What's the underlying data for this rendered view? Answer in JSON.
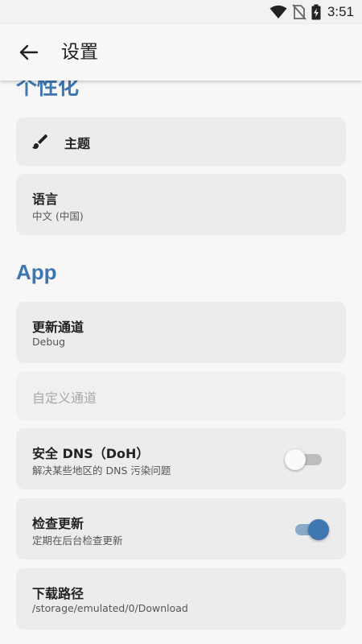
{
  "status_bar": {
    "time": "3:51"
  },
  "app_bar": {
    "title": "设置"
  },
  "sections": {
    "personalization": {
      "header": "个性化"
    },
    "app": {
      "header": "App"
    }
  },
  "items": {
    "theme": {
      "title": "主题"
    },
    "language": {
      "title": "语言",
      "value": "中文 (中国)"
    },
    "update_channel": {
      "title": "更新通道",
      "value": "Debug"
    },
    "custom_channel": {
      "placeholder": "自定义通道"
    },
    "secure_dns": {
      "title": "安全 DNS（DoH）",
      "subtitle": "解决某些地区的 DNS 污染问题",
      "enabled": false
    },
    "check_updates": {
      "title": "检查更新",
      "subtitle": "定期在后台检查更新",
      "enabled": true
    },
    "download_path": {
      "title": "下载路径",
      "value": "/storage/emulated/0/Download"
    }
  },
  "colors": {
    "accent": "#3d76b0",
    "card_background": "#ececec",
    "page_background": "#f7f7f7"
  },
  "icons": [
    "wifi-icon",
    "no-sim-icon",
    "battery-charging-icon",
    "back-arrow-icon",
    "brush-icon"
  ]
}
